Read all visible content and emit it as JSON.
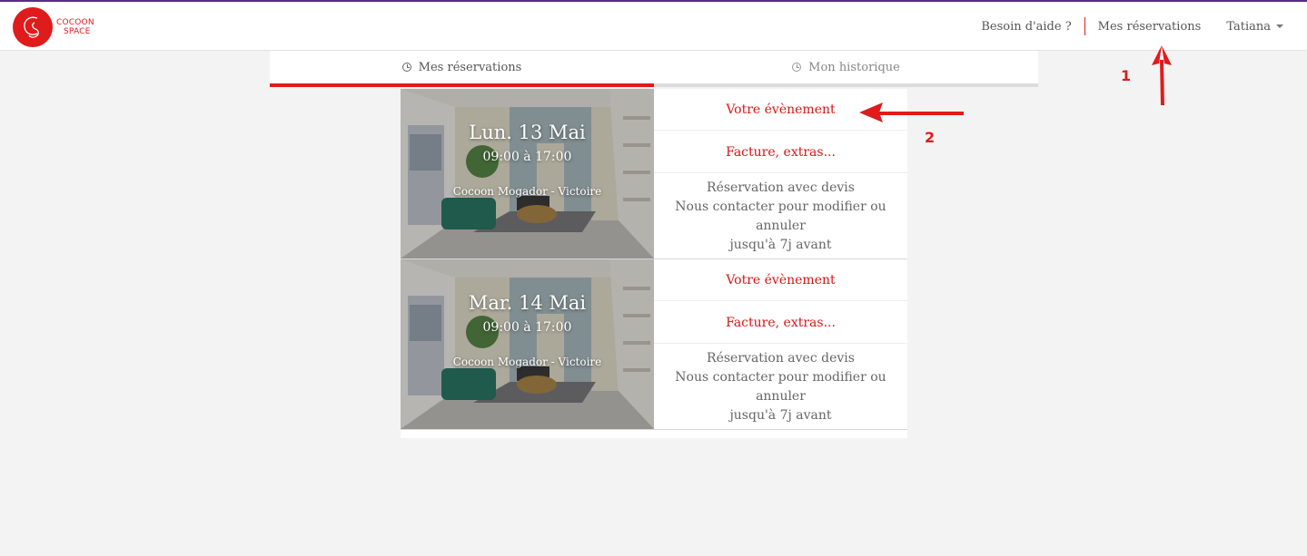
{
  "brand": {
    "line1": "COCOON",
    "line2": "SPACE",
    "color": "#e01b1b"
  },
  "nav": {
    "help": "Besoin d'aide ?",
    "reservations": "Mes réservations",
    "user": "Tatiana"
  },
  "tabs": [
    {
      "label": "Mes réservations",
      "active": true
    },
    {
      "label": "Mon historique",
      "active": false
    }
  ],
  "reservations": [
    {
      "date": "Lun. 13 Mai",
      "time": "09:00 à 17:00",
      "place": "Cocoon Mogador - Victoire",
      "event_link": "Votre évènement",
      "invoice_link": "Facture, extras...",
      "info_line1": "Réservation avec devis",
      "info_line2": "Nous contacter pour modifier ou annuler",
      "info_line3": "jusqu'à 7j avant"
    },
    {
      "date": "Mar. 14 Mai",
      "time": "09:00 à 17:00",
      "place": "Cocoon Mogador - Victoire",
      "event_link": "Votre évènement",
      "invoice_link": "Facture, extras...",
      "info_line1": "Réservation avec devis",
      "info_line2": "Nous contacter pour modifier ou annuler",
      "info_line3": "jusqu'à 7j avant"
    }
  ],
  "annotations": {
    "one": "1",
    "two": "2"
  }
}
